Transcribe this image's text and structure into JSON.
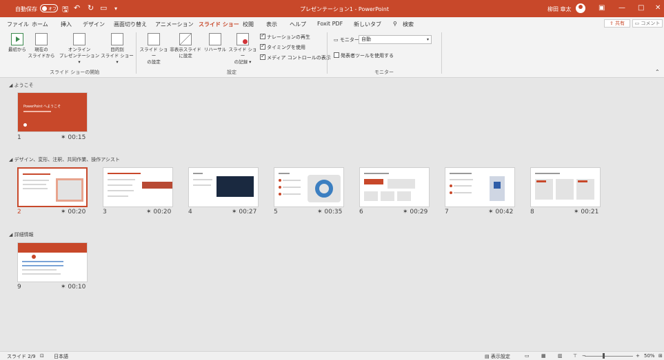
{
  "titlebar": {
    "autosave_label": "自動保存",
    "autosave_state": "オフ",
    "document_title": "プレゼンテーション1 - PowerPoint",
    "user_name": "柳田 章太"
  },
  "menu": {
    "tabs": [
      "ファイル",
      "ホーム",
      "挿入",
      "デザイン",
      "画面切り替え",
      "アニメーション",
      "スライド ショー",
      "校閲",
      "表示",
      "ヘルプ",
      "Foxit PDF",
      "新しいタブ"
    ],
    "active_tab": "スライド ショー",
    "search": "検索",
    "share": "共有",
    "comment": "コメント"
  },
  "ribbon": {
    "from_beginning": "最初から",
    "from_current_1": "現在の",
    "from_current_2": "スライドから",
    "online_1": "オンライン",
    "online_2": "プレゼンテーション",
    "custom_1": "目的別",
    "custom_2": "スライド ショー",
    "group_start": "スライド ショーの開始",
    "setup_1": "スライド ショー",
    "setup_2": "の設定",
    "hide_1": "非表示スライド",
    "hide_2": "に設定",
    "rehearse": "リハーサル",
    "record_1": "スライド ショー",
    "record_2": "の記録",
    "play_narration": "ナレーションの再生",
    "use_timings": "タイミングを使用",
    "show_media": "メディア コントロールの表示",
    "group_setup": "設定",
    "monitor_label": "モニター:",
    "monitor_value": "自動",
    "presenter_view": "発表者ツールを使用する",
    "group_monitor": "モニター"
  },
  "sections": {
    "welcome": "ようこそ",
    "design": "デザイン、変形、注釈、共同作業、操作アシスト",
    "details": "詳細情報"
  },
  "slides": [
    {
      "number": "1",
      "time": "00:15",
      "title": "PowerPoint へようこそ"
    },
    {
      "number": "2",
      "time": "00:20"
    },
    {
      "number": "3",
      "time": "00:20"
    },
    {
      "number": "4",
      "time": "00:27"
    },
    {
      "number": "5",
      "time": "00:35"
    },
    {
      "number": "6",
      "time": "00:29"
    },
    {
      "number": "7",
      "time": "00:42"
    },
    {
      "number": "8",
      "time": "00:21"
    },
    {
      "number": "9",
      "time": "00:10"
    }
  ],
  "statusbar": {
    "slide_count": "スライド 2/9",
    "language": "日本語",
    "display_settings": "表示設定",
    "zoom": "50%"
  },
  "colors": {
    "accent": "#c8482a",
    "background": "#e6e6e6"
  }
}
